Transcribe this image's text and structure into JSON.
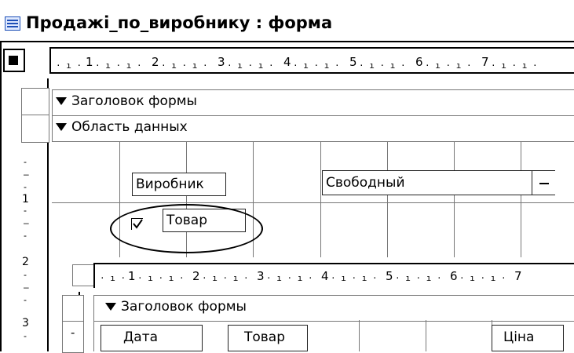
{
  "window": {
    "title": "Продажі_по_виробнику : форма"
  },
  "ruler": {
    "top_numbers": [
      "1",
      "2",
      "3",
      "4",
      "5",
      "6",
      "7"
    ],
    "left_numbers": [
      "1",
      "2",
      "3"
    ]
  },
  "sections": {
    "header": "Заголовок формы",
    "detail": "Область данных"
  },
  "controls": {
    "vyrobnyk_label": "Виробник",
    "combo_value": "Свободный",
    "tovar_label": "Товар"
  },
  "subform": {
    "ruler_numbers": [
      "1",
      "2",
      "3",
      "4",
      "5",
      "6",
      "7"
    ],
    "header": "Заголовок формы",
    "columns": [
      "Дата",
      "Товар",
      "Ціна"
    ],
    "row_marker": "-"
  }
}
